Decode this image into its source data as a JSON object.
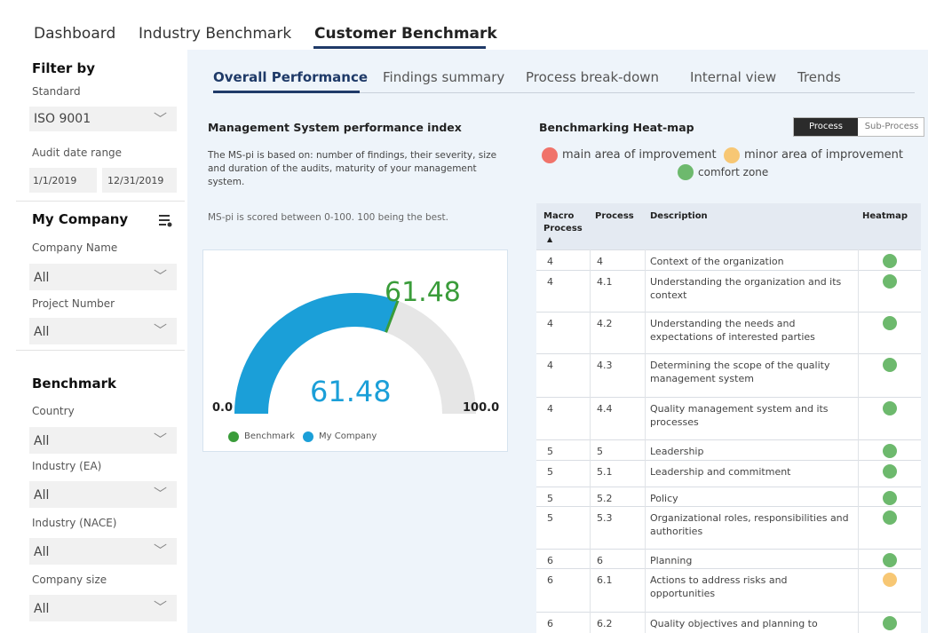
{
  "nav": {
    "tabs": [
      "Dashboard",
      "Industry Benchmark",
      "Customer Benchmark"
    ],
    "active": "Customer Benchmark"
  },
  "sidebar": {
    "filter_title": "Filter by",
    "standard_label": "Standard",
    "standard_value": "ISO 9001",
    "audit_label": "Audit date range",
    "date_from": "1/1/2019",
    "date_to": "12/31/2019",
    "my_company_title": "My Company",
    "company_name_label": "Company Name",
    "company_name_value": "All",
    "project_label": "Project Number",
    "project_value": "All",
    "benchmark_title": "Benchmark",
    "country_label": "Country",
    "country_value": "All",
    "industry_ea_label": "Industry (EA)",
    "industry_ea_value": "All",
    "industry_nace_label": "Industry (NACE)",
    "industry_nace_value": "All",
    "company_size_label": "Company size",
    "company_size_value": "All"
  },
  "subtabs": [
    "Overall Performance",
    "Findings summary",
    "Process break-down",
    "Internal view",
    "Trends"
  ],
  "msi": {
    "title": "Management System performance index",
    "description": "The MS-pi is based on: number of findings, their severity, size and duration of the audits, maturity of your management system.",
    "note": "MS-pi is scored between 0-100. 100 being the best."
  },
  "gauge": {
    "min_label": "0.0",
    "max_label": "100.0",
    "benchmark_value": 61.48,
    "my_company_value": 61.48,
    "benchmark_text": "61.48",
    "my_company_text": "61.48",
    "legend": [
      "Benchmark",
      "My Company"
    ],
    "colors": {
      "benchmark": "#3a9c3a",
      "my_company": "#1b9fd8",
      "track": "#e6e6e6"
    }
  },
  "heatmap": {
    "title": "Benchmarking Heat-map",
    "toggle": [
      "Process",
      "Sub-Process"
    ],
    "legend": [
      "main area of improvement",
      "minor area of improvement",
      "comfort zone"
    ],
    "colors": {
      "main": "#f0736a",
      "minor": "#f7c774",
      "comfort": "#6db96d"
    },
    "columns": [
      "Macro Process",
      "Process",
      "Description",
      "Heatmap"
    ],
    "rows": [
      {
        "macro": "4",
        "process": "4",
        "description": "Context of the organization",
        "level": "comfort"
      },
      {
        "macro": "4",
        "process": "4.1",
        "description": "Understanding the organization and its context",
        "level": "comfort"
      },
      {
        "macro": "4",
        "process": "4.2",
        "description": "Understanding the needs and expectations of interested parties",
        "level": "comfort"
      },
      {
        "macro": "4",
        "process": "4.3",
        "description": "Determining the scope of the quality management system",
        "level": "comfort"
      },
      {
        "macro": "4",
        "process": "4.4",
        "description": "Quality management system and its processes",
        "level": "comfort"
      },
      {
        "macro": "5",
        "process": "5",
        "description": "Leadership",
        "level": "comfort"
      },
      {
        "macro": "5",
        "process": "5.1",
        "description": "Leadership and commitment",
        "level": "comfort"
      },
      {
        "macro": "5",
        "process": "5.2",
        "description": "Policy",
        "level": "comfort"
      },
      {
        "macro": "5",
        "process": "5.3",
        "description": "Organizational roles, responsibilities and authorities",
        "level": "comfort"
      },
      {
        "macro": "6",
        "process": "6",
        "description": "Planning",
        "level": "comfort"
      },
      {
        "macro": "6",
        "process": "6.1",
        "description": "Actions to address risks and opportunities",
        "level": "minor"
      },
      {
        "macro": "6",
        "process": "6.2",
        "description": "Quality objectives and planning to",
        "level": "comfort"
      }
    ]
  }
}
